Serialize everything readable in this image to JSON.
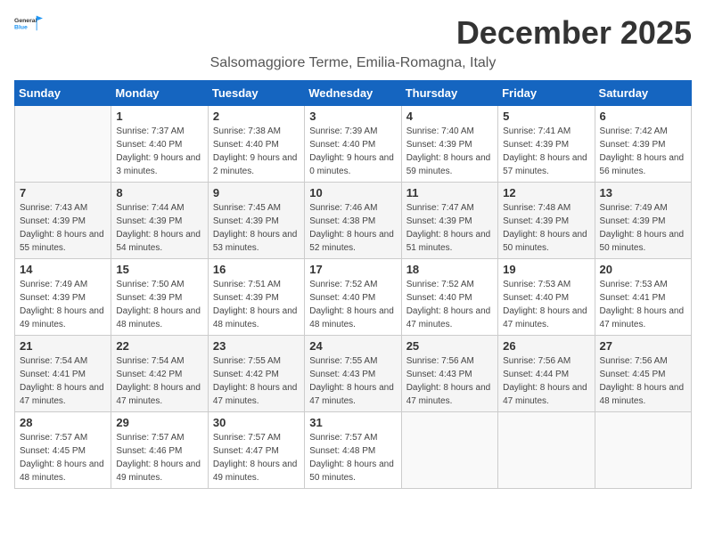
{
  "header": {
    "logo_general": "General",
    "logo_blue": "Blue",
    "month_title": "December 2025",
    "subtitle": "Salsomaggiore Terme, Emilia-Romagna, Italy"
  },
  "weekdays": [
    "Sunday",
    "Monday",
    "Tuesday",
    "Wednesday",
    "Thursday",
    "Friday",
    "Saturday"
  ],
  "weeks": [
    [
      {
        "day": "",
        "sunrise": "",
        "sunset": "",
        "daylight": ""
      },
      {
        "day": "1",
        "sunrise": "Sunrise: 7:37 AM",
        "sunset": "Sunset: 4:40 PM",
        "daylight": "Daylight: 9 hours and 3 minutes."
      },
      {
        "day": "2",
        "sunrise": "Sunrise: 7:38 AM",
        "sunset": "Sunset: 4:40 PM",
        "daylight": "Daylight: 9 hours and 2 minutes."
      },
      {
        "day": "3",
        "sunrise": "Sunrise: 7:39 AM",
        "sunset": "Sunset: 4:40 PM",
        "daylight": "Daylight: 9 hours and 0 minutes."
      },
      {
        "day": "4",
        "sunrise": "Sunrise: 7:40 AM",
        "sunset": "Sunset: 4:39 PM",
        "daylight": "Daylight: 8 hours and 59 minutes."
      },
      {
        "day": "5",
        "sunrise": "Sunrise: 7:41 AM",
        "sunset": "Sunset: 4:39 PM",
        "daylight": "Daylight: 8 hours and 57 minutes."
      },
      {
        "day": "6",
        "sunrise": "Sunrise: 7:42 AM",
        "sunset": "Sunset: 4:39 PM",
        "daylight": "Daylight: 8 hours and 56 minutes."
      }
    ],
    [
      {
        "day": "7",
        "sunrise": "Sunrise: 7:43 AM",
        "sunset": "Sunset: 4:39 PM",
        "daylight": "Daylight: 8 hours and 55 minutes."
      },
      {
        "day": "8",
        "sunrise": "Sunrise: 7:44 AM",
        "sunset": "Sunset: 4:39 PM",
        "daylight": "Daylight: 8 hours and 54 minutes."
      },
      {
        "day": "9",
        "sunrise": "Sunrise: 7:45 AM",
        "sunset": "Sunset: 4:39 PM",
        "daylight": "Daylight: 8 hours and 53 minutes."
      },
      {
        "day": "10",
        "sunrise": "Sunrise: 7:46 AM",
        "sunset": "Sunset: 4:38 PM",
        "daylight": "Daylight: 8 hours and 52 minutes."
      },
      {
        "day": "11",
        "sunrise": "Sunrise: 7:47 AM",
        "sunset": "Sunset: 4:39 PM",
        "daylight": "Daylight: 8 hours and 51 minutes."
      },
      {
        "day": "12",
        "sunrise": "Sunrise: 7:48 AM",
        "sunset": "Sunset: 4:39 PM",
        "daylight": "Daylight: 8 hours and 50 minutes."
      },
      {
        "day": "13",
        "sunrise": "Sunrise: 7:49 AM",
        "sunset": "Sunset: 4:39 PM",
        "daylight": "Daylight: 8 hours and 50 minutes."
      }
    ],
    [
      {
        "day": "14",
        "sunrise": "Sunrise: 7:49 AM",
        "sunset": "Sunset: 4:39 PM",
        "daylight": "Daylight: 8 hours and 49 minutes."
      },
      {
        "day": "15",
        "sunrise": "Sunrise: 7:50 AM",
        "sunset": "Sunset: 4:39 PM",
        "daylight": "Daylight: 8 hours and 48 minutes."
      },
      {
        "day": "16",
        "sunrise": "Sunrise: 7:51 AM",
        "sunset": "Sunset: 4:39 PM",
        "daylight": "Daylight: 8 hours and 48 minutes."
      },
      {
        "day": "17",
        "sunrise": "Sunrise: 7:52 AM",
        "sunset": "Sunset: 4:40 PM",
        "daylight": "Daylight: 8 hours and 48 minutes."
      },
      {
        "day": "18",
        "sunrise": "Sunrise: 7:52 AM",
        "sunset": "Sunset: 4:40 PM",
        "daylight": "Daylight: 8 hours and 47 minutes."
      },
      {
        "day": "19",
        "sunrise": "Sunrise: 7:53 AM",
        "sunset": "Sunset: 4:40 PM",
        "daylight": "Daylight: 8 hours and 47 minutes."
      },
      {
        "day": "20",
        "sunrise": "Sunrise: 7:53 AM",
        "sunset": "Sunset: 4:41 PM",
        "daylight": "Daylight: 8 hours and 47 minutes."
      }
    ],
    [
      {
        "day": "21",
        "sunrise": "Sunrise: 7:54 AM",
        "sunset": "Sunset: 4:41 PM",
        "daylight": "Daylight: 8 hours and 47 minutes."
      },
      {
        "day": "22",
        "sunrise": "Sunrise: 7:54 AM",
        "sunset": "Sunset: 4:42 PM",
        "daylight": "Daylight: 8 hours and 47 minutes."
      },
      {
        "day": "23",
        "sunrise": "Sunrise: 7:55 AM",
        "sunset": "Sunset: 4:42 PM",
        "daylight": "Daylight: 8 hours and 47 minutes."
      },
      {
        "day": "24",
        "sunrise": "Sunrise: 7:55 AM",
        "sunset": "Sunset: 4:43 PM",
        "daylight": "Daylight: 8 hours and 47 minutes."
      },
      {
        "day": "25",
        "sunrise": "Sunrise: 7:56 AM",
        "sunset": "Sunset: 4:43 PM",
        "daylight": "Daylight: 8 hours and 47 minutes."
      },
      {
        "day": "26",
        "sunrise": "Sunrise: 7:56 AM",
        "sunset": "Sunset: 4:44 PM",
        "daylight": "Daylight: 8 hours and 47 minutes."
      },
      {
        "day": "27",
        "sunrise": "Sunrise: 7:56 AM",
        "sunset": "Sunset: 4:45 PM",
        "daylight": "Daylight: 8 hours and 48 minutes."
      }
    ],
    [
      {
        "day": "28",
        "sunrise": "Sunrise: 7:57 AM",
        "sunset": "Sunset: 4:45 PM",
        "daylight": "Daylight: 8 hours and 48 minutes."
      },
      {
        "day": "29",
        "sunrise": "Sunrise: 7:57 AM",
        "sunset": "Sunset: 4:46 PM",
        "daylight": "Daylight: 8 hours and 49 minutes."
      },
      {
        "day": "30",
        "sunrise": "Sunrise: 7:57 AM",
        "sunset": "Sunset: 4:47 PM",
        "daylight": "Daylight: 8 hours and 49 minutes."
      },
      {
        "day": "31",
        "sunrise": "Sunrise: 7:57 AM",
        "sunset": "Sunset: 4:48 PM",
        "daylight": "Daylight: 8 hours and 50 minutes."
      },
      {
        "day": "",
        "sunrise": "",
        "sunset": "",
        "daylight": ""
      },
      {
        "day": "",
        "sunrise": "",
        "sunset": "",
        "daylight": ""
      },
      {
        "day": "",
        "sunrise": "",
        "sunset": "",
        "daylight": ""
      }
    ]
  ]
}
